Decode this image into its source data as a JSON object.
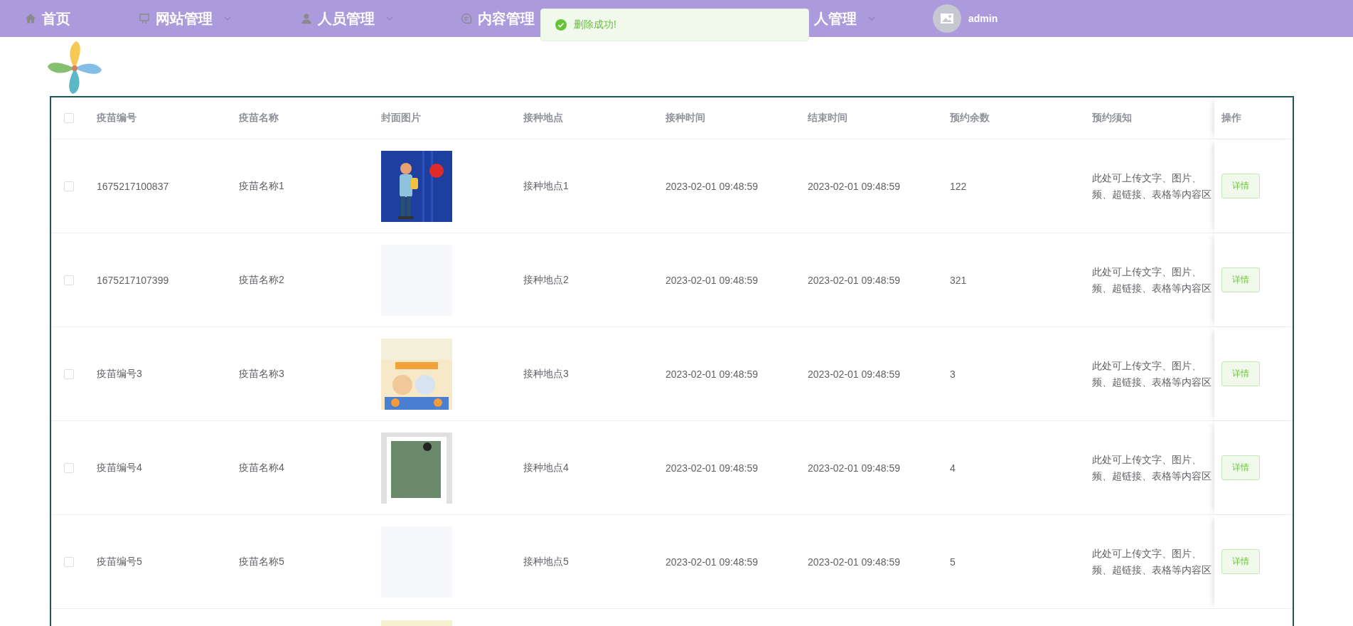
{
  "nav": {
    "items": [
      {
        "label": "首页",
        "dropdown": false
      },
      {
        "label": "网站管理",
        "dropdown": true
      },
      {
        "label": "人员管理",
        "dropdown": true
      },
      {
        "label": "内容管理",
        "dropdown": false
      },
      {
        "label": "人管理",
        "dropdown": true
      }
    ],
    "user": {
      "name": "admin"
    }
  },
  "toast": {
    "kind": "success",
    "message": "删除成功!"
  },
  "table": {
    "header_checkbox": {
      "checked": false
    },
    "columns": [
      "疫苗编号",
      "疫苗名称",
      "封面图片",
      "接种地点",
      "接种时间",
      "结束时间",
      "预约余数",
      "预约须知",
      "操作"
    ],
    "rows": [
      {
        "checked": false,
        "code": "1675217100837",
        "name": "疫苗名称1",
        "image": {
          "kind": "picture"
        },
        "place": "接种地点1",
        "start": "2023-02-01 09:48:59",
        "end": "2023-02-01 09:48:59",
        "remaining": "122",
        "notice": [
          "此处可上传文字、图片、",
          "频、超链接、表格等内容区"
        ],
        "action": "详情"
      },
      {
        "checked": false,
        "code": "1675217107399",
        "name": "疫苗名称2",
        "place": "接种地点2",
        "start": "2023-02-01 09:48:59",
        "end": "2023-02-01 09:48:59",
        "remaining": "321",
        "notice": [
          "此处可上传文字、图片、",
          "频、超链接、表格等内容区"
        ],
        "action": "详情"
      },
      {
        "checked": false,
        "code": "疫苗编号3",
        "name": "疫苗名称3",
        "image": {
          "kind": "picture"
        },
        "place": "接种地点3",
        "start": "2023-02-01 09:48:59",
        "end": "2023-02-01 09:48:59",
        "remaining": "3",
        "notice": [
          "此处可上传文字、图片、",
          "频、超链接、表格等内容区"
        ],
        "action": "详情"
      },
      {
        "checked": false,
        "code": "疫苗编号4",
        "name": "疫苗名称4",
        "image": {
          "kind": "picture"
        },
        "place": "接种地点4",
        "start": "2023-02-01 09:48:59",
        "end": "2023-02-01 09:48:59",
        "remaining": "4",
        "notice": [
          "此处可上传文字、图片、",
          "频、超链接、表格等内容区"
        ],
        "action": "详情"
      },
      {
        "checked": false,
        "code": "疫苗编号5",
        "name": "疫苗名称5",
        "place": "接种地点5",
        "start": "2023-02-01 09:48:59",
        "end": "2023-02-01 09:48:59",
        "remaining": "5",
        "notice": [
          "此处可上传文字、图片、",
          "频、超链接、表格等内容区"
        ],
        "action": "详情"
      },
      {
        "image": {
          "kind": "picture"
        }
      }
    ]
  }
}
